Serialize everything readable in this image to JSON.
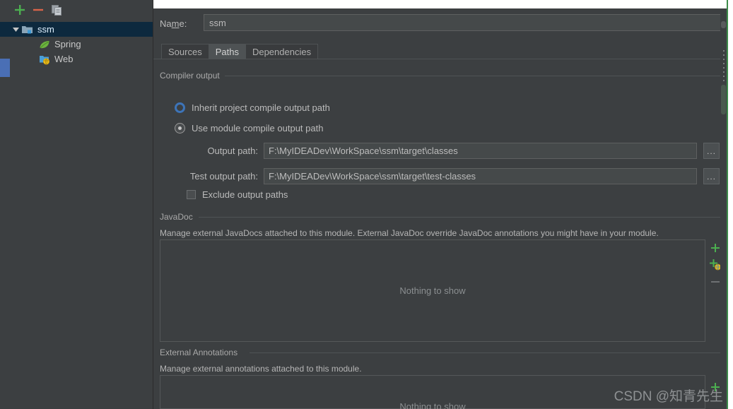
{
  "window": {
    "watermark": "CSDN @知青先生"
  },
  "tree_toolbar": {
    "add": "+",
    "remove": "−",
    "copy": "copy-icon"
  },
  "tree": {
    "items": [
      {
        "label": "ssm",
        "icon": "module-folder-icon",
        "selected": true,
        "expanded": true,
        "depth": 0
      },
      {
        "label": "Spring",
        "icon": "spring-leaf-icon",
        "selected": false,
        "expanded": false,
        "depth": 1
      },
      {
        "label": "Web",
        "icon": "web-folder-icon",
        "selected": false,
        "expanded": false,
        "depth": 1
      }
    ]
  },
  "name_field": {
    "label_before": "Na",
    "label_mnemonic": "m",
    "label_after": "e:",
    "value": "ssm"
  },
  "tabs": [
    {
      "label": "Sources",
      "active": false
    },
    {
      "label": "Paths",
      "active": true
    },
    {
      "label": "Dependencies",
      "active": false
    }
  ],
  "compiler_output": {
    "title": "Compiler output",
    "radios": [
      {
        "label": "Inherit project compile output path",
        "state": "focused"
      },
      {
        "label": "Use module compile output path",
        "state": "checked"
      }
    ],
    "output_path": {
      "label": "Output path:",
      "value": "F:\\MyIDEADev\\WorkSpace\\ssm\\target\\classes",
      "browse": "..."
    },
    "test_output_path": {
      "label": "Test output path:",
      "value": "F:\\MyIDEADev\\WorkSpace\\ssm\\target\\test-classes",
      "browse": "..."
    },
    "exclude_checkbox": {
      "label": "Exclude output paths",
      "checked": false
    }
  },
  "javadoc": {
    "title": "JavaDoc",
    "description": "Manage external JavaDocs attached to this module. External JavaDoc override JavaDoc annotations you might have in your module.",
    "empty_text": "Nothing to show",
    "actions": [
      {
        "name": "add-javadoc-path",
        "glyph": "+"
      },
      {
        "name": "add-javadoc-url",
        "glyph": "+"
      },
      {
        "name": "remove-javadoc",
        "glyph": "−"
      }
    ]
  },
  "external_annotations": {
    "title": "External Annotations",
    "description": "Manage external annotations attached to this module.",
    "empty_text": "Nothing to show",
    "actions": [
      {
        "name": "add-annotation-path",
        "glyph": "+"
      }
    ]
  }
}
